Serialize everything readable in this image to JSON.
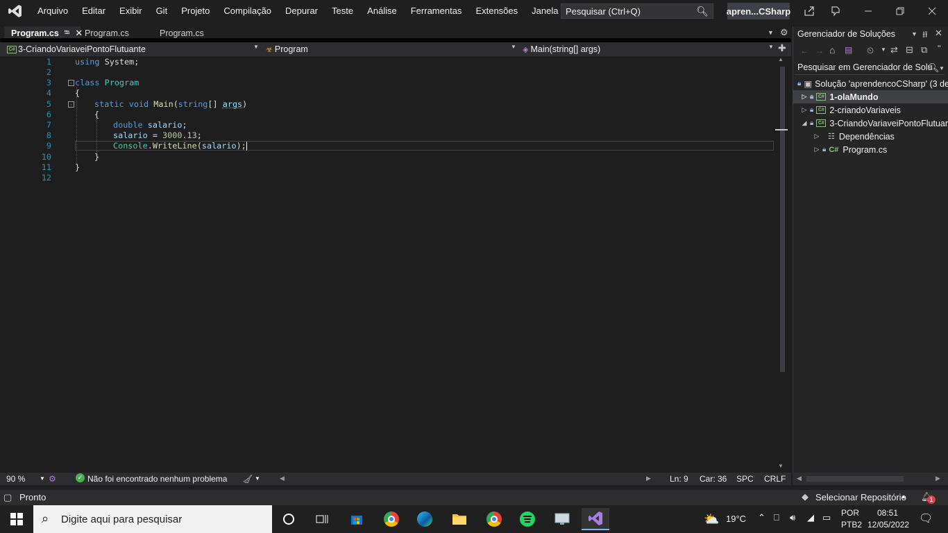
{
  "menu": {
    "items": [
      "Arquivo",
      "Editar",
      "Exibir",
      "Git",
      "Projeto",
      "Compilação",
      "Depurar",
      "Teste",
      "Análise",
      "Ferramentas",
      "Extensões",
      "Janela",
      "Ajuda"
    ],
    "search_placeholder": "Pesquisar (Ctrl+Q)",
    "solution_badge": "apren...CSharp"
  },
  "tabs": [
    {
      "label": "Program.cs",
      "active": true
    },
    {
      "label": "Program.cs",
      "active": false
    },
    {
      "label": "Program.cs",
      "active": false
    }
  ],
  "navbar": {
    "project": "3-CriandoVariaveiPontoFlutuante",
    "class": "Program",
    "member": "Main(string[] args)"
  },
  "editor": {
    "line_numbers": [
      "1",
      "2",
      "3",
      "4",
      "5",
      "6",
      "7",
      "8",
      "9",
      "10",
      "11",
      "12"
    ],
    "lines": {
      "l1_kw": "using",
      "l1_rest": " System;",
      "l3_kw": "class",
      "l3_ty": "Program",
      "l4": "{",
      "l5_kw1": "static",
      "l5_kw2": "void",
      "l5_fn": "Main",
      "l5_open": "(",
      "l5_kw3": "string",
      "l5_br": "[] ",
      "l5_vr": "args",
      "l5_close": ")",
      "l6": "{",
      "l7_kw": "double",
      "l7_vr": "salario",
      "l7_end": ";",
      "l8_vr": "salario",
      "l8_eq": " = ",
      "l8_nm": "3000.13",
      "l8_end": ";",
      "l9_ty": "Console",
      "l9_dot": ".",
      "l9_fn": "WriteLine",
      "l9_open": "(",
      "l9_vr": "salario",
      "l9_end": ");",
      "l10": "}",
      "l11": "}"
    }
  },
  "editor_status": {
    "zoom": "90 %",
    "issues": "Não foi encontrado nenhum problema",
    "line": "Ln: 9",
    "char": "Car: 36",
    "spaces": "SPC",
    "eol": "CRLF"
  },
  "solution_explorer": {
    "title": "Gerenciador de Soluções",
    "search": "Pesquisar em Gerenciador de Solu",
    "tree": [
      {
        "label": "Solução 'aprendencoCSharp' (3 de"
      },
      {
        "label": "1-olaMundo"
      },
      {
        "label": "2-criandoVariaveis"
      },
      {
        "label": "3-CriandoVariaveiPontoFlutuar"
      },
      {
        "label": "Dependências"
      },
      {
        "label": "Program.cs"
      }
    ]
  },
  "statusbar": {
    "ready": "Pronto",
    "repo": "Selecionar Repositório",
    "notifications": "1"
  },
  "taskbar": {
    "search_placeholder": "Digite aqui para pesquisar",
    "temperature": "19°C",
    "language": "POR",
    "layout": "PTB2",
    "time": "08:51",
    "date": "12/05/2022"
  }
}
